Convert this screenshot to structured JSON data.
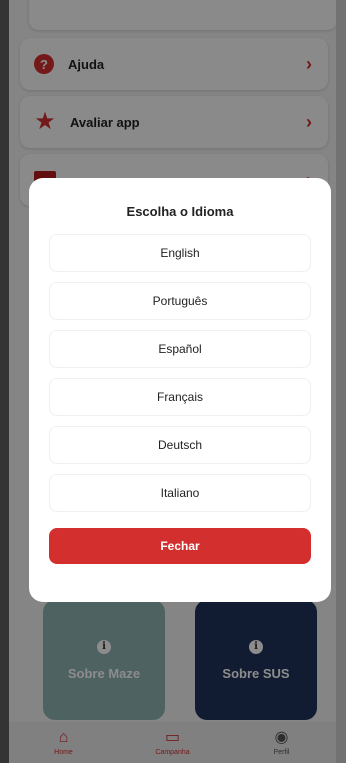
{
  "menu": {
    "items": [
      {
        "label": "Ajuda",
        "icon": "help-icon"
      },
      {
        "label": "Avaliar app",
        "icon": "star-icon"
      },
      {
        "label": "",
        "icon": "map-icon"
      }
    ],
    "chevron": "›"
  },
  "tiles": {
    "maze_label": "Sobre Maze",
    "sus_label": "Sobre SUS",
    "info_glyph": "i"
  },
  "nav": {
    "items": [
      {
        "label": "Home",
        "icon": "home-icon",
        "glyph": "⌂"
      },
      {
        "label": "Campanha",
        "icon": "campaign-icon",
        "glyph": "▭"
      },
      {
        "label": "Perfil",
        "icon": "profile-icon",
        "glyph": "◉"
      }
    ]
  },
  "modal": {
    "title": "Escolha o Idioma",
    "languages": [
      "English",
      "Português",
      "Español",
      "Français",
      "Deutsch",
      "Italiano"
    ],
    "close_label": "Fechar"
  },
  "colors": {
    "accent": "#d32f2f",
    "maze_tile": "#8fb2b3",
    "sus_tile": "#20325a"
  }
}
